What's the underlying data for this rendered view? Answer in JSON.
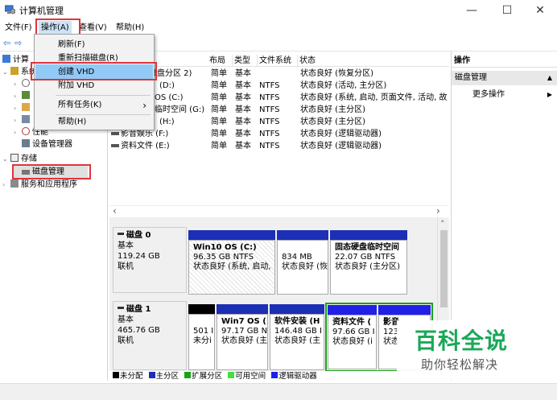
{
  "window": {
    "title": "计算机管理",
    "minimize": "—",
    "maximize": "☐",
    "close": "✕"
  },
  "menubar": [
    "文件(F)",
    "操作(A)",
    "查看(V)",
    "帮助(H)"
  ],
  "toolbar": {
    "back": "⇦",
    "forward": "⇨"
  },
  "context_menu": {
    "items": [
      "刷新(F)",
      "重新扫描磁盘(R)",
      "创建 VHD",
      "附加 VHD",
      "所有任务(K)",
      "帮助(H)"
    ],
    "submenu_arrow": "›",
    "highlighted": "创建 VHD"
  },
  "tree": {
    "visible_fragments": [
      "计算",
      "系统"
    ],
    "items": [
      {
        "label": "性能"
      },
      {
        "label": "设备管理器"
      },
      {
        "label": "存储"
      },
      {
        "label": "磁盘管理"
      },
      {
        "label": "服务和应用程序"
      }
    ]
  },
  "volume_list": {
    "headers": [
      "布局",
      "类型",
      "文件系统",
      "状态"
    ],
    "rows": [
      {
        "name": "磁盘分区 2)",
        "layout": "简单",
        "type": "基本",
        "fs": "",
        "status": "状态良好 (恢复分区)"
      },
      {
        "name": "(D:)",
        "layout": "简单",
        "type": "基本",
        "fs": "NTFS",
        "status": "状态良好 (活动, 主分区)"
      },
      {
        "name": "OS (C:)",
        "layout": "简单",
        "type": "基本",
        "fs": "NTFS",
        "status": "状态良好 (系统, 启动, 页面文件, 活动, 故"
      },
      {
        "name": "临时空间 (G:)",
        "layout": "简单",
        "type": "基本",
        "fs": "NTFS",
        "status": "状态良好 (主分区)"
      },
      {
        "name": "(H:)",
        "layout": "简单",
        "type": "基本",
        "fs": "NTFS",
        "status": "状态良好 (主分区)"
      },
      {
        "name": "影音娱乐 (F:)",
        "layout": "简单",
        "type": "基本",
        "fs": "NTFS",
        "status": "状态良好 (逻辑驱动器)"
      },
      {
        "name": "资料文件 (E:)",
        "layout": "简单",
        "type": "基本",
        "fs": "NTFS",
        "status": "状态良好 (逻辑驱动器)"
      }
    ]
  },
  "disks": [
    {
      "name": "磁盘 0",
      "kind": "基本",
      "size": "119.24 GB",
      "state": "联机",
      "partitions": [
        {
          "title": "Win10 OS  (C:)",
          "line1": "96.35 GB NTFS",
          "line2": "状态良好 (系统, 启动,"
        },
        {
          "title": "",
          "line1": "834 MB",
          "line2": "状态良好 (恢"
        },
        {
          "title": "固态硬盘临时空间",
          "line1": "22.07 GB NTFS",
          "line2": "状态良好 (主分区)"
        }
      ]
    },
    {
      "name": "磁盘 1",
      "kind": "基本",
      "size": "465.76 GB",
      "state": "联机",
      "partitions": [
        {
          "title": "",
          "line1": "501 I",
          "line2": "未分i"
        },
        {
          "title": "Win7 OS  (",
          "line1": "97.17 GB N",
          "line2": "状态良好 (主"
        },
        {
          "title": "软件安装 (H",
          "line1": "146.48 GB I",
          "line2": "状态良好 (主"
        },
        {
          "title": "资料文件 (",
          "line1": "97.66 GB I",
          "line2": "状态良好 (i"
        },
        {
          "title": "影音",
          "line1": "123",
          "line2": "状态"
        }
      ]
    }
  ],
  "legend": [
    {
      "label": "未分配",
      "color": "#000000"
    },
    {
      "label": "主分区",
      "color": "#1c2fb5"
    },
    {
      "label": "扩展分区",
      "color": "#19a319"
    },
    {
      "label": "可用空间",
      "color": "#40e040"
    },
    {
      "label": "逻辑驱动器",
      "color": "#2020e8"
    }
  ],
  "actions": {
    "header": "操作",
    "section": "磁盘管理",
    "section_arrow": "▲",
    "more": "更多操作",
    "more_arrow": "▶"
  },
  "scroll": {
    "left": "‹",
    "right": "›",
    "up": "˄"
  },
  "watermark": {
    "title": "百科全说",
    "subtitle": "助你轻松解决"
  },
  "colors": {
    "highlight_box": "#e0353a",
    "primary_bar": "#1c2fb5",
    "logical_bar": "#2020e8",
    "extended_border": "#19a319",
    "watermark_green": "#1aa85a"
  }
}
